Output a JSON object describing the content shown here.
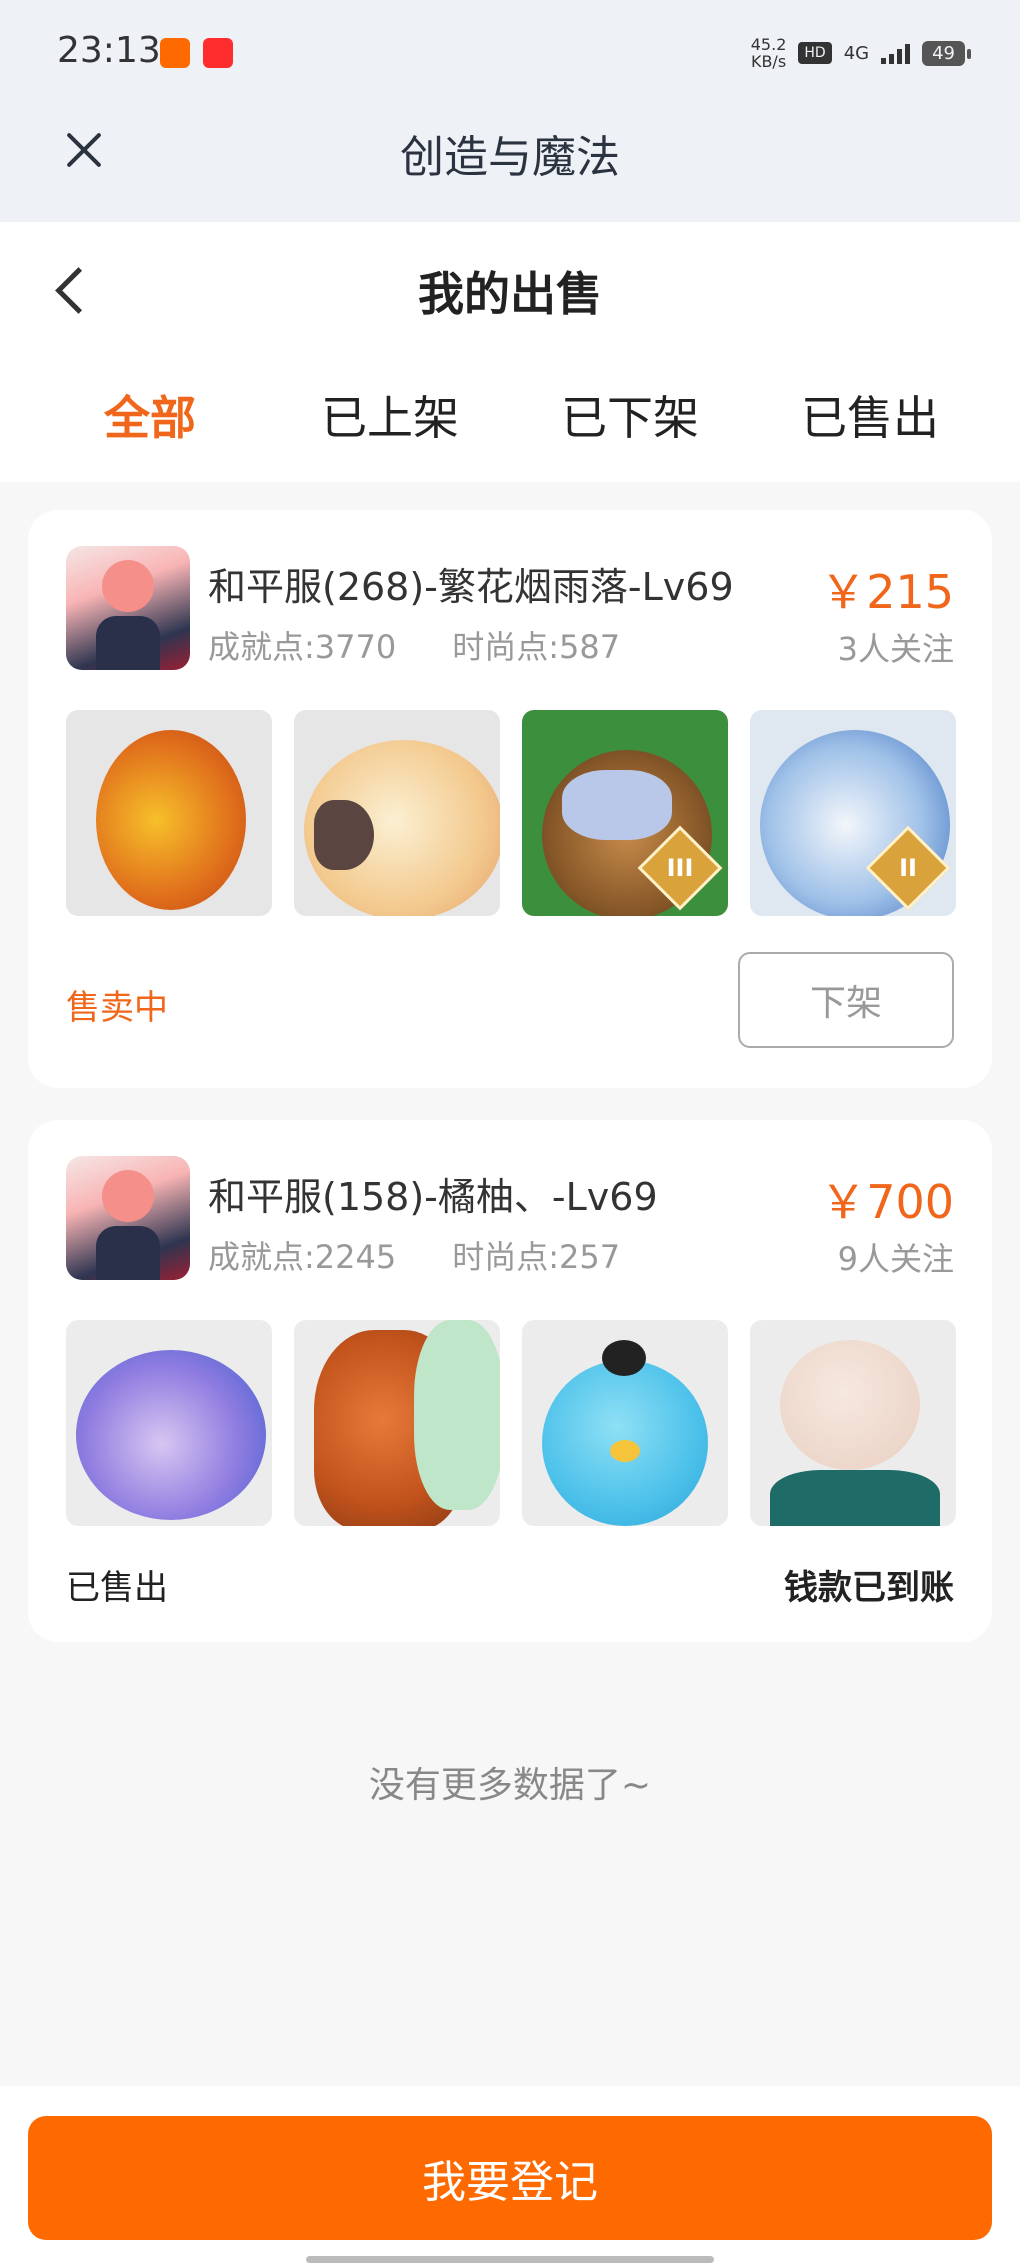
{
  "status_bar": {
    "time": "23:13",
    "net_speed_value": "45.2",
    "net_speed_unit": "KB/s",
    "hd": "HD",
    "network": "4G",
    "battery": "49"
  },
  "top_nav": {
    "title": "创造与魔法",
    "close_icon": "close-icon"
  },
  "header": {
    "title": "我的出售",
    "back_icon": "chevron-left-icon"
  },
  "tabs": [
    {
      "label": "全部",
      "active": true
    },
    {
      "label": "已上架",
      "active": false
    },
    {
      "label": "已下架",
      "active": false
    },
    {
      "label": "已售出",
      "active": false
    }
  ],
  "listings": [
    {
      "title": "和平服(268)-繁花烟雨落-Lv69",
      "achievement": "成就点:3770",
      "fashion": "时尚点:587",
      "price": "￥215",
      "followers": "3人关注",
      "status": "售卖中",
      "action": "下架",
      "thumbs": [
        {
          "name": "phoenix-pet-image"
        },
        {
          "name": "cockatoo-pet-image"
        },
        {
          "name": "lion-pet-image",
          "tier": "III"
        },
        {
          "name": "tiger-pet-image",
          "tier": "II"
        }
      ]
    },
    {
      "title": "和平服(158)-橘柚、-Lv69",
      "achievement": "成就点:2245",
      "fashion": "时尚点:257",
      "price": "￥700",
      "followers": "9人关注",
      "status": "已售出",
      "settlement": "钱款已到账",
      "thumbs": [
        {
          "name": "dragon-pet-image"
        },
        {
          "name": "horse-pet-image"
        },
        {
          "name": "bird-pet-image"
        },
        {
          "name": "bald-character-image"
        }
      ]
    }
  ],
  "footer_note": "没有更多数据了~",
  "bottom_button": "我要登记",
  "colors": {
    "accent": "#f0661a",
    "button": "#ff6a00",
    "background": "#f7f7f8"
  }
}
